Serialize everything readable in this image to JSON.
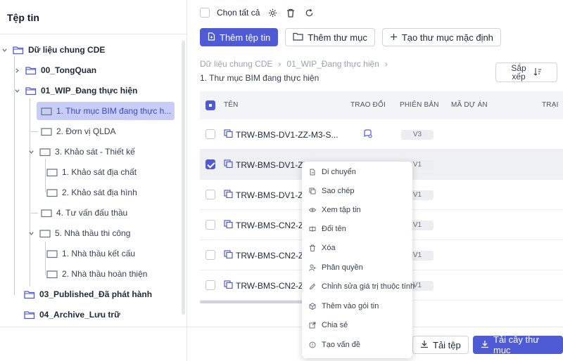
{
  "left_panel": {
    "title": "Tệp tin",
    "tree": [
      {
        "label": "Dữ liệu chung CDE"
      },
      {
        "label": "00_TongQuan"
      },
      {
        "label": "01_WIP_Đang thực hiện"
      },
      {
        "label": "1. Thư mục BIM đang thực h..."
      },
      {
        "label": "2. Đơn vị QLDA"
      },
      {
        "label": "3. Khảo sát - Thiết kế"
      },
      {
        "label": "1. Khảo sát địa chất"
      },
      {
        "label": "2. Khảo sát địa hình"
      },
      {
        "label": "4. Tư vấn đấu thầu"
      },
      {
        "label": "5. Nhà thầu thi công"
      },
      {
        "label": "1. Nhà thầu kết cấu"
      },
      {
        "label": "2. Nhà thầu hoàn thiện"
      },
      {
        "label": "03_Published_Đã phát hành"
      },
      {
        "label": "04_Archive_Lưu trữ"
      }
    ]
  },
  "toolbar": {
    "select_all": "Chọn tất cả",
    "add_file": "Thêm tệp tin",
    "add_folder": "Thêm thư mục",
    "create_default_folder": "Tạo thư mục mặc định"
  },
  "breadcrumb": {
    "items": [
      "Dữ liệu chung CDE",
      "01_WIP_Đang thực hiện"
    ],
    "current": "1. Thư mục BIM đang thực hiện"
  },
  "sort": {
    "line1": "Sắp",
    "line2": "xếp"
  },
  "table": {
    "headers": {
      "name": "TÊN",
      "exchange": "TRAO ĐỔI",
      "version": "PHIÊN BẢN",
      "project_code": "MÃ DỰ ÁN",
      "status": "TRẠI"
    },
    "rows": [
      {
        "name": "TRW-BMS-DV1-ZZ-M3-S...",
        "version": "V3"
      },
      {
        "name": "TRW-BMS-DV1-ZZ-M3",
        "version": "V1"
      },
      {
        "name": "TRW-BMS-DV1-Z",
        "version": "V1"
      },
      {
        "name": "TRW-BMS-CN2-Z",
        "version": "V1"
      },
      {
        "name": "TRW-BMS-CN2-Z",
        "version": "V1"
      },
      {
        "name": "TRW-BMS-CN2-Z",
        "version": "V1"
      }
    ]
  },
  "context_menu": {
    "items": [
      "Di chuyển",
      "Sao chép",
      "Xem tập tin",
      "Đổi tên",
      "Xóa",
      "Phân quyền",
      "Chỉnh sửa giá trị thuộc tính",
      "Thêm vào gói tin",
      "Chia sẻ",
      "Tạo vấn đề"
    ]
  },
  "footer": {
    "download_file": "Tải tệp",
    "download_tree": "Tải cây thư mục"
  },
  "colors": {
    "accent": "#4f5bd5",
    "selected_node": "#c7cdf7"
  }
}
